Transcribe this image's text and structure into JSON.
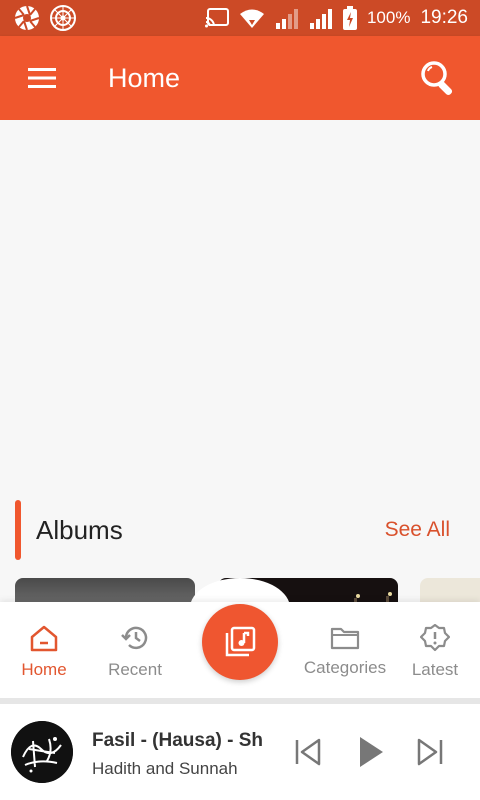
{
  "status_bar": {
    "battery": "100%",
    "time": "19:26",
    "icons": [
      "aperture-icon",
      "mandala-icon",
      "cast-icon",
      "wifi-icon",
      "signal-icon",
      "signal-icon",
      "battery-charging-icon"
    ]
  },
  "app_bar": {
    "title": "Home",
    "menu_icon": "hamburger-menu-icon",
    "search_icon": "search-icon"
  },
  "albums_section": {
    "title": "Albums",
    "see_all": "See All"
  },
  "bottom_nav": {
    "items": [
      {
        "label": "Home",
        "icon": "home-icon",
        "active": true
      },
      {
        "label": "Recent",
        "icon": "history-icon",
        "active": false
      },
      {
        "label": "Categories",
        "icon": "folder-icon",
        "active": false
      },
      {
        "label": "Latest",
        "icon": "badge-alert-icon",
        "active": false
      }
    ],
    "fab_icon": "music-library-icon"
  },
  "player": {
    "title": "Fasil - (Hausa) - Sh",
    "subtitle": "Hadith and Sunnah",
    "controls": [
      "skip-previous-icon",
      "play-icon",
      "skip-next-icon"
    ]
  },
  "colors": {
    "accent": "#f0572e",
    "status_bar": "#cc4a26",
    "nav_inactive": "#8c8c8c",
    "see_all": "#d9512c"
  }
}
